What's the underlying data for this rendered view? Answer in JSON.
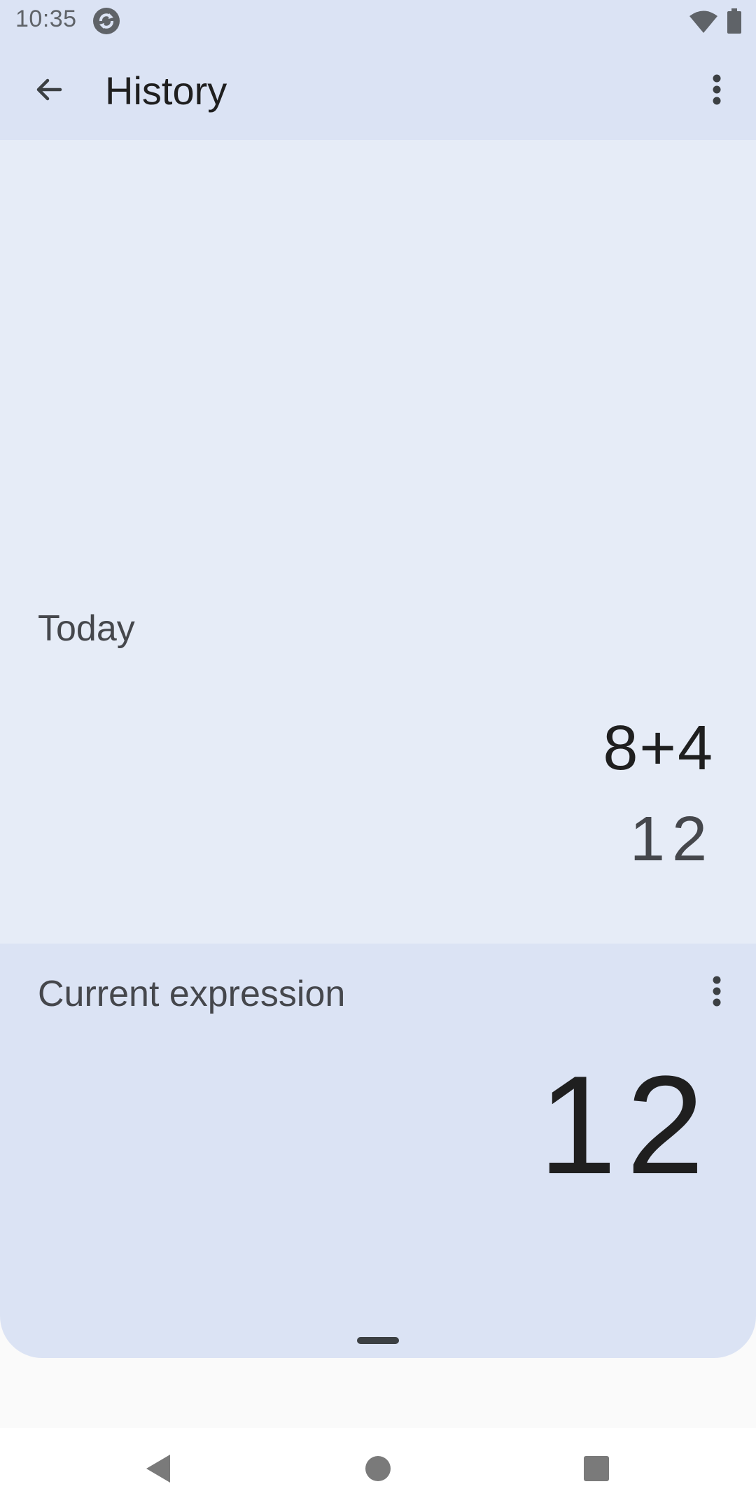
{
  "status_bar": {
    "time": "10:35",
    "icons": [
      "app-sync-icon",
      "wifi-icon",
      "battery-icon"
    ]
  },
  "app_bar": {
    "title": "History",
    "back_icon": "arrow-back-icon",
    "menu_icon": "more-vert-icon"
  },
  "history": {
    "sections": [
      {
        "header": "Today",
        "entries": [
          {
            "expression": "8+4",
            "result": "12"
          }
        ]
      }
    ]
  },
  "current": {
    "label": "Current expression",
    "value": "12",
    "menu_icon": "more-vert-icon"
  },
  "nav_bar": {
    "icons": [
      "nav-back-icon",
      "nav-home-icon",
      "nav-recents-icon"
    ]
  },
  "colors": {
    "app_bar_bg": "#dbe3f4",
    "history_bg": "#e6ecf7",
    "text_primary": "#1f1f1f",
    "text_secondary": "#45474c"
  }
}
